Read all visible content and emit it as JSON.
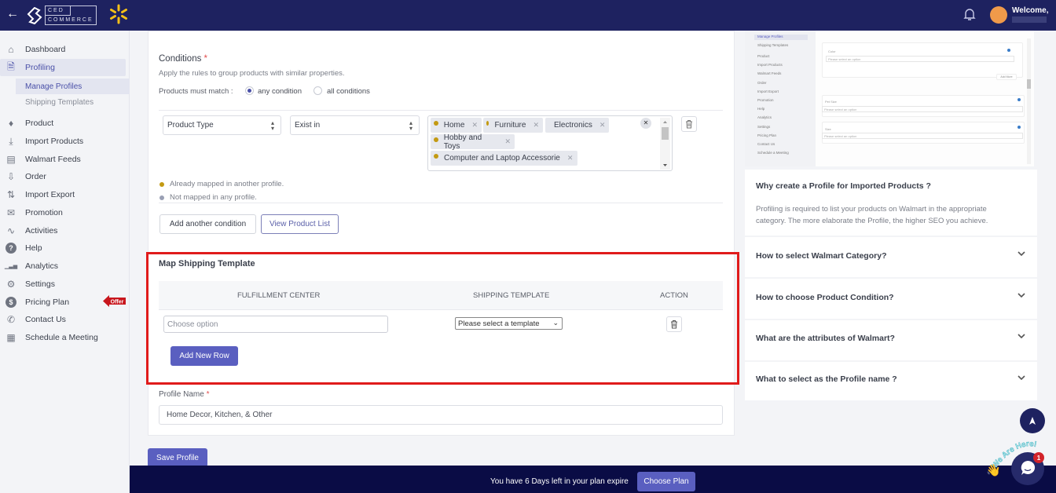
{
  "header": {
    "back_icon": "arrow-left-icon",
    "logo_top": "CED",
    "logo_bottom": "COMMERCE",
    "marketplace_icon": "walmart-spark-icon",
    "notification_icon": "bell-icon",
    "welcome": "Welcome,"
  },
  "sidebar": {
    "items": [
      {
        "label": "Dashboard",
        "icon": "home-icon"
      },
      {
        "label": "Profiling",
        "icon": "profile-add-icon",
        "active": true
      },
      {
        "label": "Product",
        "icon": "tag-icon"
      },
      {
        "label": "Import Products",
        "icon": "download-icon"
      },
      {
        "label": "Walmart Feeds",
        "icon": "archive-icon"
      },
      {
        "label": "Order",
        "icon": "inbox-download-icon"
      },
      {
        "label": "Import Export",
        "icon": "arrows-updown-icon"
      },
      {
        "label": "Promotion",
        "icon": "megaphone-icon"
      },
      {
        "label": "Activities",
        "icon": "activity-icon"
      },
      {
        "label": "Help",
        "icon": "help-icon"
      },
      {
        "label": "Analytics",
        "icon": "bar-chart-icon"
      },
      {
        "label": "Settings",
        "icon": "gear-icon"
      },
      {
        "label": "Pricing Plan",
        "icon": "dollar-icon"
      },
      {
        "label": "Contact Us",
        "icon": "phone-icon"
      },
      {
        "label": "Schedule a Meeting",
        "icon": "calendar-icon"
      }
    ],
    "sub_items": [
      {
        "label": "Manage Profiles",
        "active": true
      },
      {
        "label": "Shipping Templates"
      }
    ],
    "offer_badge": "Offer"
  },
  "conditions": {
    "title": "Conditions",
    "required_mark": "*",
    "description": "Apply the rules to group products with similar properties.",
    "match_label": "Products must match :",
    "match_options": [
      {
        "label": "any condition",
        "selected": true
      },
      {
        "label": "all conditions",
        "selected": false
      }
    ],
    "attribute_select": "Product Type",
    "operator_select": "Exist in",
    "chips": [
      "Home",
      "Furniture",
      "Electronics",
      "Hobby and Toys",
      "Computer and Laptop Accessorie"
    ],
    "legend": [
      {
        "label": "Already mapped in another profile.",
        "color": "#c39a12"
      },
      {
        "label": "Not mapped in any profile.",
        "color": "#9aa0b4"
      }
    ],
    "add_condition_label": "Add another condition",
    "view_products_label": "View Product List"
  },
  "shipping": {
    "title": "Map Shipping Template",
    "columns": [
      "FULFILLMENT CENTER",
      "SHIPPING TEMPLATE",
      "ACTION"
    ],
    "row": {
      "fulfillment_placeholder": "Choose option",
      "template_value": "Please select a template"
    },
    "add_row_label": "Add New Row"
  },
  "profile_name": {
    "label": "Profile Name",
    "required_mark": "*",
    "value": "Home Decor, Kitchen, & Other"
  },
  "save_label": "Save Profile",
  "plan_banner": {
    "text": "You have 6 Days left in your plan expire",
    "button": "Choose Plan"
  },
  "faq": {
    "intro_title": "Why create a Profile for Imported Products ?",
    "intro_body": "Profiling is required to list your products on Walmart in the appropriate category. The more elaborate the Profile, the higher SEO you achieve.",
    "questions": [
      "How to select Walmart Category?",
      "How to choose Product Condition?",
      "What are the attributes of Walmart?",
      "What to select as the Profile name ?"
    ]
  },
  "preview": {
    "sub_items": [
      "Manage Profiles",
      "Shipping Templates"
    ],
    "items": [
      "Product",
      "Import Products",
      "Walmart Feeds",
      "Order",
      "Import Export",
      "Promotion",
      "Help",
      "Analytics",
      "Settings",
      "Pricing Plan",
      "Contact Us",
      "Schedule a Meeting"
    ],
    "fields": [
      {
        "label": "Color",
        "placeholder": "Please select an option"
      },
      {
        "label": "Pet Size",
        "placeholder": "Please select an option"
      },
      {
        "label": "Size",
        "placeholder": "Please select an option"
      }
    ],
    "add_more": "Add More"
  },
  "chat": {
    "badge_count": "1",
    "tagline": "We Are Here!"
  },
  "colors": {
    "header_bg": "#1e2260",
    "primary": "#5a5fc0",
    "highlight_border": "#e01b1b",
    "mapped_dot": "#c39a12",
    "banner_bg": "#0a0c45"
  }
}
